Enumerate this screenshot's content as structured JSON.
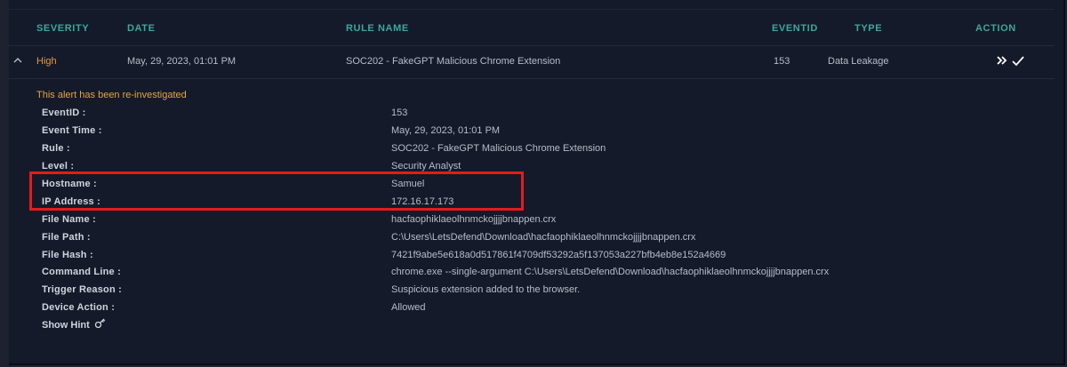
{
  "table": {
    "headers": {
      "severity": "SEVERITY",
      "date": "DATE",
      "rule_name": "RULE NAME",
      "eventid": "EVENTID",
      "type": "TYPE",
      "action": "ACTION"
    },
    "alert": {
      "severity": "High",
      "date": "May, 29, 2023, 01:01 PM",
      "rule_name": "SOC202 - FakeGPT Malicious Chrome Extension",
      "eventid": "153",
      "type": "Data Leakage",
      "severity_color": "#e39a3c"
    }
  },
  "details": {
    "notice": "This alert has been re-investigated",
    "rows": [
      {
        "label": "EventID :",
        "value": "153"
      },
      {
        "label": "Event Time :",
        "value": "May, 29, 2023, 01:01 PM"
      },
      {
        "label": "Rule :",
        "value": "SOC202 - FakeGPT Malicious Chrome Extension"
      },
      {
        "label": "Level :",
        "value": "Security Analyst"
      },
      {
        "label": "Hostname :",
        "value": "Samuel"
      },
      {
        "label": "IP Address :",
        "value": "172.16.17.173"
      },
      {
        "label": "File Name :",
        "value": "hacfaophiklaeolhnmckojjjjbnappen.crx"
      },
      {
        "label": "File Path :",
        "value": "C:\\Users\\LetsDefend\\Download\\hacfaophiklaeolhnmckojjjjbnappen.crx"
      },
      {
        "label": "File Hash :",
        "value": "7421f9abe5e618a0d517861f4709df53292a5f137053a227bfb4eb8e152a4669"
      },
      {
        "label": "Command Line :",
        "value": "chrome.exe --single-argument C:\\Users\\LetsDefend\\Download\\hacfaophiklaeolhnmckojjjjbnappen.crx"
      },
      {
        "label": "Trigger Reason :",
        "value": "Suspicious extension added to the browser."
      },
      {
        "label": "Device Action :",
        "value": "Allowed"
      }
    ],
    "show_hint": "Show Hint"
  },
  "icons": {
    "collapse": "chevron-up-icon",
    "escalate": "double-chevron-right-icon",
    "close": "checkmark-icon",
    "hint": "key-icon"
  },
  "colors": {
    "accent_teal": "#3da89a",
    "warning_orange": "#e3a63c",
    "highlight_red": "#e31c1c"
  }
}
